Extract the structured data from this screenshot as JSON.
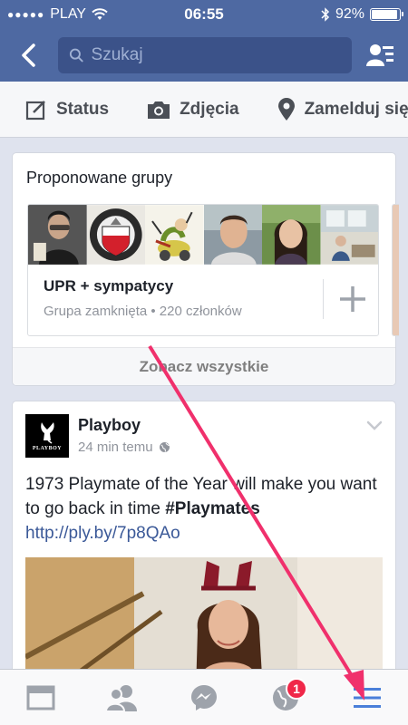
{
  "status_bar": {
    "carrier": "PLAY",
    "time": "06:55",
    "battery": "92%",
    "battery_level": 0.92
  },
  "nav": {
    "search_placeholder": "Szukaj",
    "back_icon": "chevron-left-icon",
    "friends_icon": "friend-requests-icon"
  },
  "actions": [
    {
      "label": "Status",
      "icon": "edit-icon"
    },
    {
      "label": "Zdjęcia",
      "icon": "camera-icon"
    },
    {
      "label": "Zamelduj się",
      "icon": "location-pin-icon"
    }
  ],
  "suggested_groups": {
    "title": "Proponowane grupy",
    "group": {
      "name": "UPR + sympatycy",
      "meta": "Grupa zamknięta • 220 członków"
    },
    "see_all": "Zobacz wszystkie"
  },
  "post": {
    "author": "Playboy",
    "avatar_text": "PLAYBOY",
    "time": "24 min temu",
    "text_before": "1973 Playmate of the Year will make you want to go back in time ",
    "hashtag": "#Playmates",
    "link": "http://ply.by/7p8QAo"
  },
  "tabbar": {
    "items": [
      {
        "icon": "news-feed-icon"
      },
      {
        "icon": "friends-icon"
      },
      {
        "icon": "messenger-icon"
      },
      {
        "icon": "notifications-globe-icon",
        "badge": "1"
      },
      {
        "icon": "menu-icon"
      }
    ]
  },
  "colors": {
    "header": "#4e69a2",
    "link": "#3b5998",
    "badge": "#f02849",
    "annotation_arrow": "#f0306c",
    "active_tab": "#4a7fd9"
  }
}
